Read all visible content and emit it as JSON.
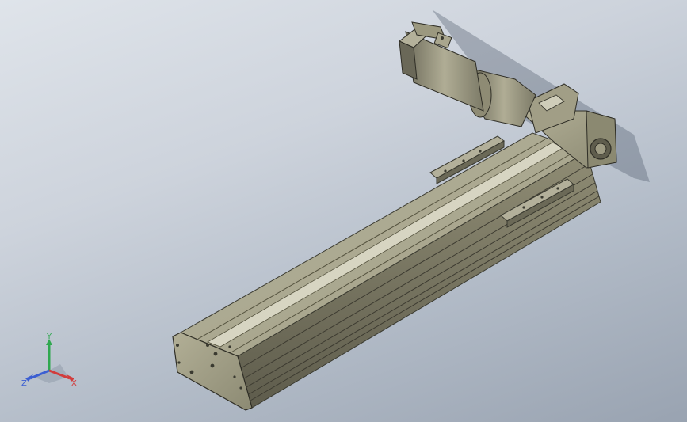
{
  "viewport": {
    "background_top": "#dfe4ea",
    "background_bottom": "#99a3b1"
  },
  "model": {
    "name": "linear-actuator-with-servo-motor",
    "body_color": "#a8a58c",
    "edge_color": "#3a3a30"
  },
  "triad": {
    "x_label": "X",
    "y_label": "Y",
    "z_label": "Z",
    "x_color": "#d23c3c",
    "y_color": "#2fa84f",
    "z_color": "#3c5fd2"
  }
}
